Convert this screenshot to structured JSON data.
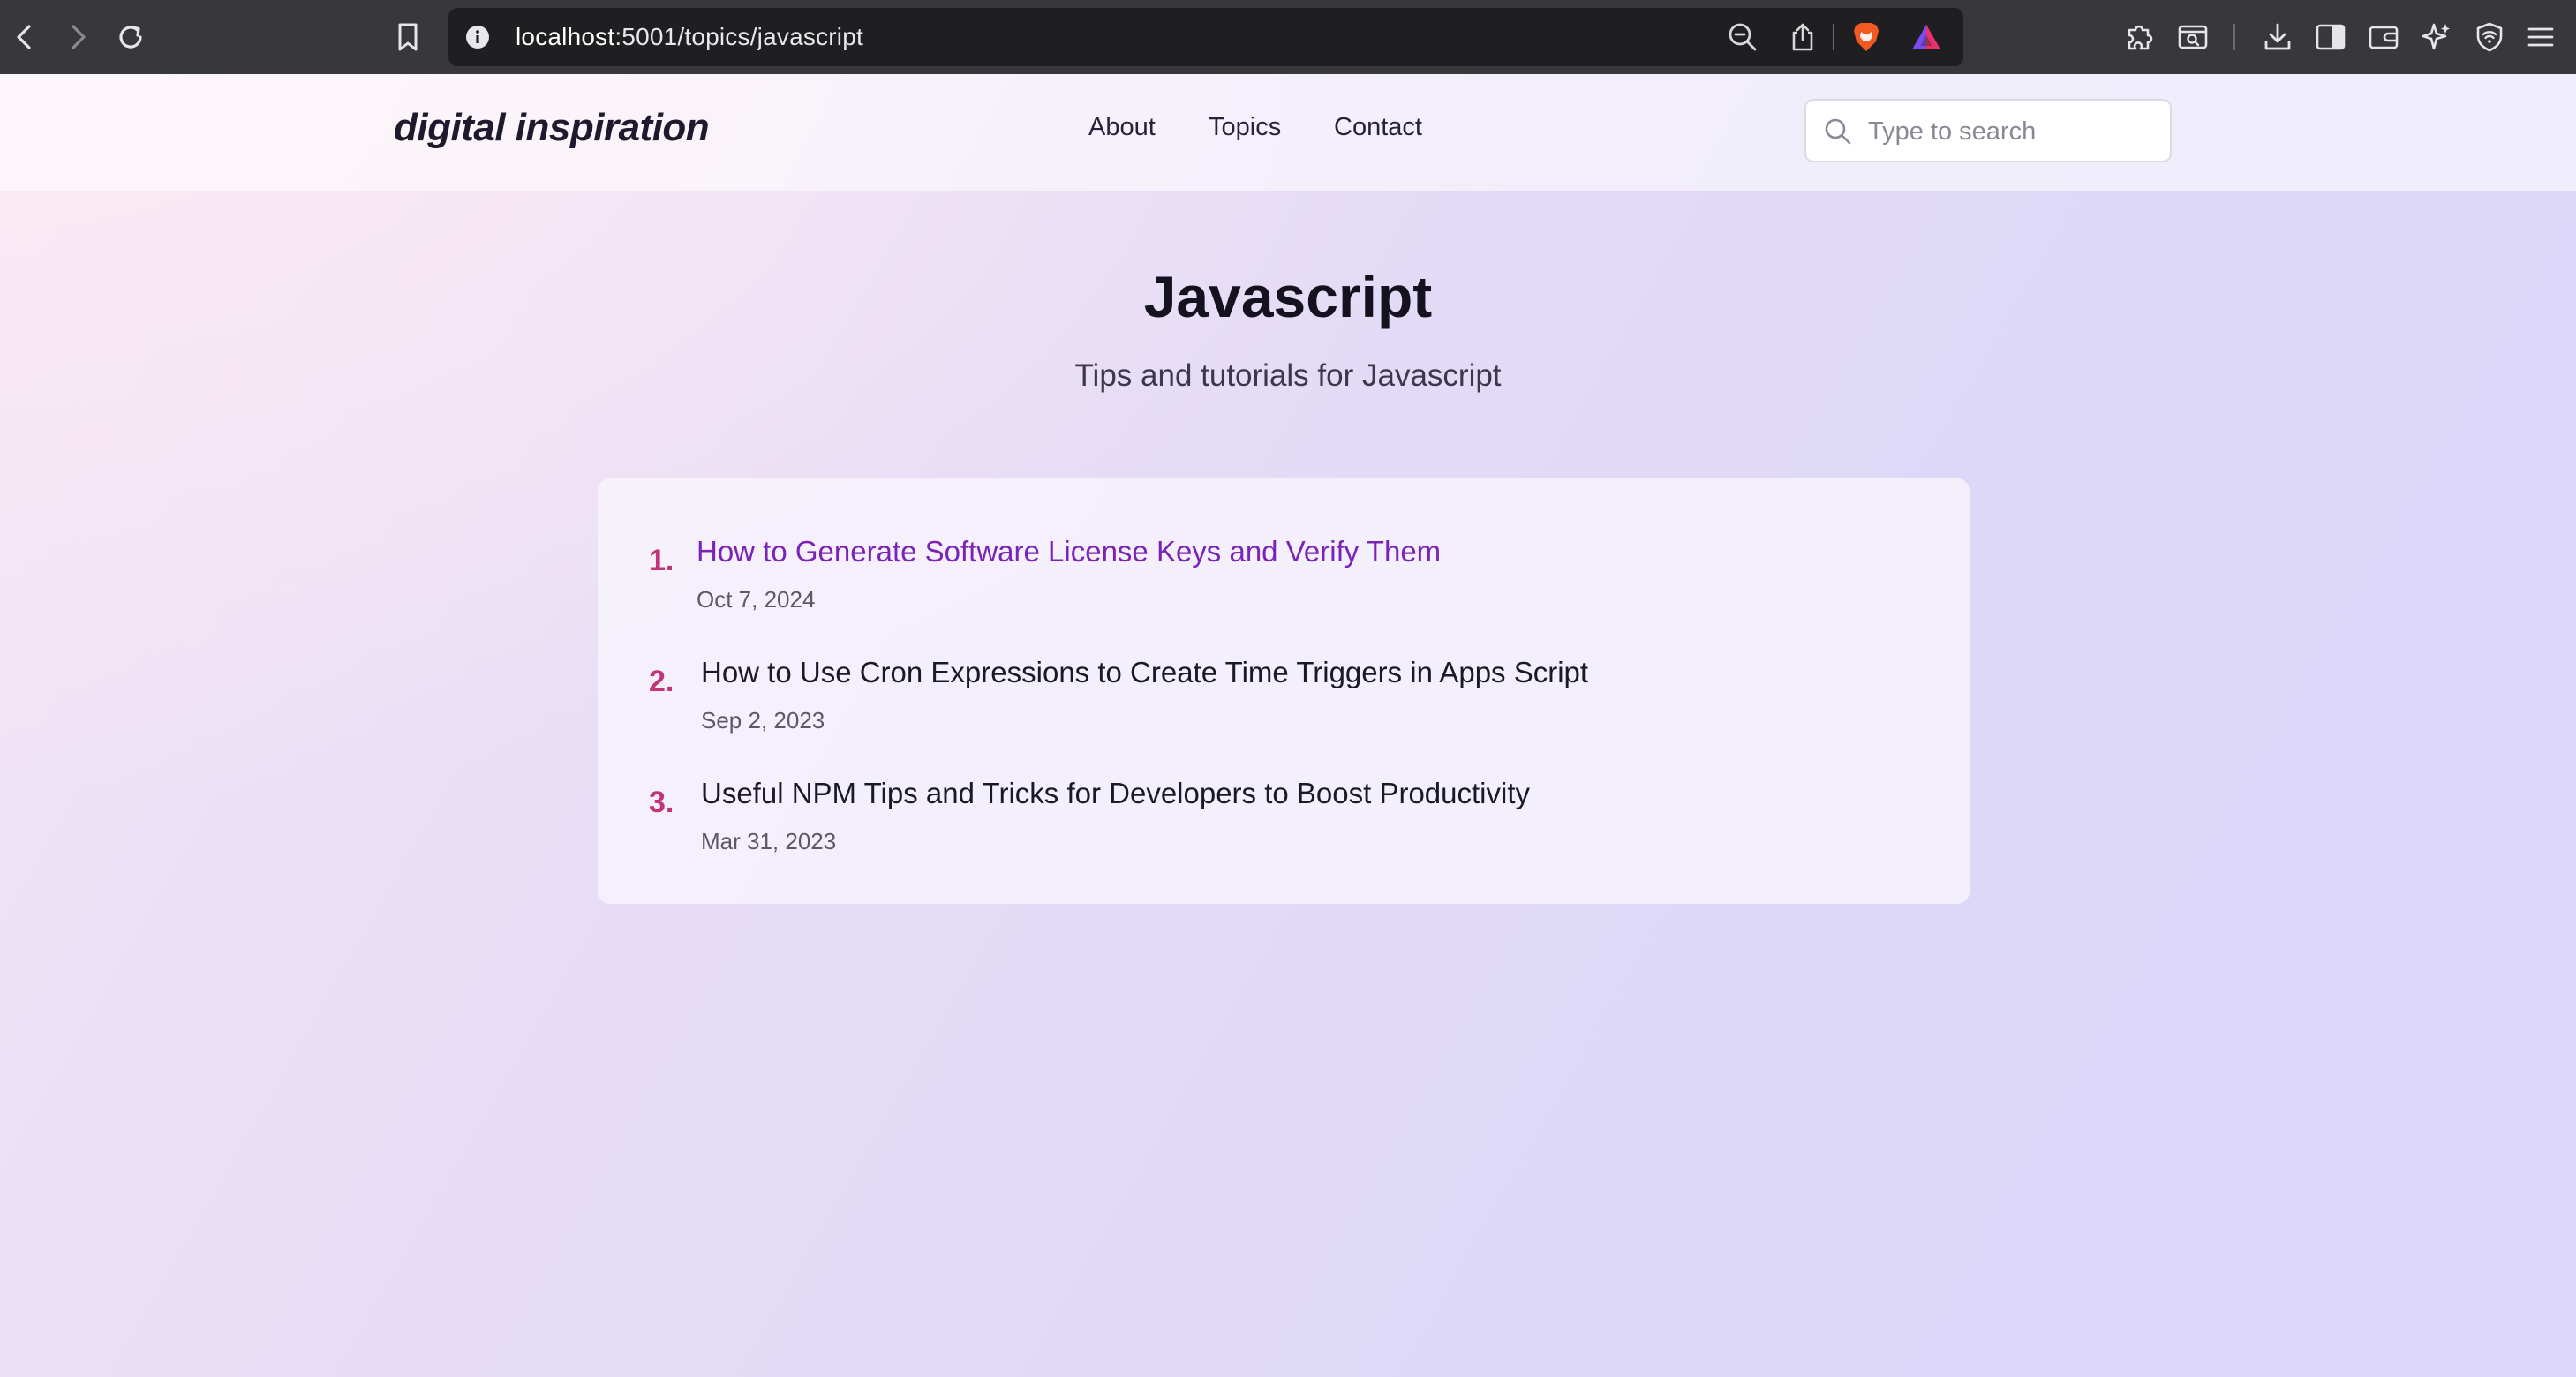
{
  "browser": {
    "url_host": "localhost",
    "url_path": ":5001/topics/javascript",
    "icons": {
      "back": "back-arrow-icon",
      "forward": "forward-arrow-icon",
      "reload": "reload-icon",
      "bookmark": "bookmark-icon",
      "site_info": "info-icon",
      "zoom": "zoom-out-icon",
      "share": "share-icon",
      "brave_shields": "brave-lion-icon",
      "brave_rewards": "brave-rewards-icon",
      "extensions": "puzzle-icon",
      "screenshot": "page-search-icon",
      "downloads": "download-icon",
      "sidebar": "sidebar-icon",
      "wallet": "wallet-icon",
      "leo": "sparkle-icon",
      "vpn": "vpn-shield-icon",
      "menu": "hamburger-menu-icon"
    }
  },
  "site": {
    "logo": "digital inspiration",
    "nav": [
      "About",
      "Topics",
      "Contact"
    ],
    "search_placeholder": "Type to search"
  },
  "main": {
    "title": "Javascript",
    "subtitle": "Tips and tutorials for Javascript",
    "articles": [
      {
        "number": "1.",
        "title": "How to Generate Software License Keys and Verify Them",
        "date": "Oct 7, 2024"
      },
      {
        "number": "2.",
        "title": "How to Use Cron Expressions to Create Time Triggers in Apps Script",
        "date": "Sep 2, 2023"
      },
      {
        "number": "3.",
        "title": "Useful NPM Tips and Tricks for Developers to Boost Productivity",
        "date": "Mar 31, 2023"
      }
    ]
  },
  "colors": {
    "chrome_bg": "#38383b",
    "urlbar_bg": "#1f1f21",
    "accent_number": "#c2347a",
    "active_link": "#7a23b8",
    "text_dark": "#15121f"
  }
}
